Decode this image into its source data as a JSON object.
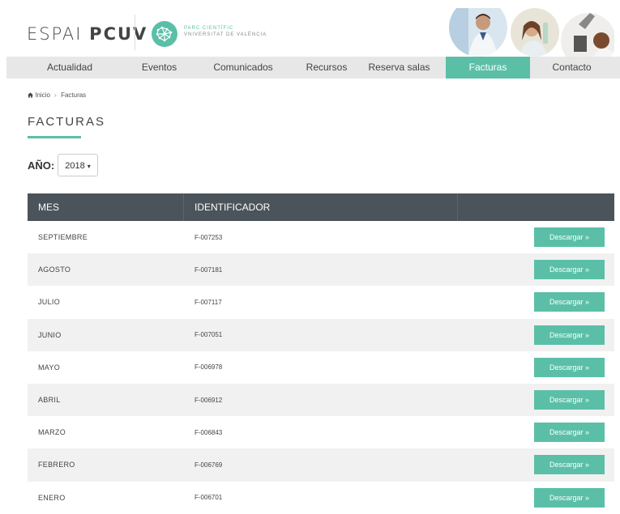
{
  "header": {
    "logo_light": "ESPAI",
    "logo_bold": "PCUV",
    "parc_line1": "PARC CIENTÍFIC",
    "parc_line2": "VNIVERSITAT DE VALÈNCIA"
  },
  "nav": {
    "items": [
      "Actualidad",
      "Eventos",
      "Comunicados",
      "Recursos",
      "Reserva salas",
      "Facturas",
      "Contacto"
    ]
  },
  "breadcrumb": {
    "home": "Inicio",
    "separator": "›",
    "current": "Facturas"
  },
  "page": {
    "title": "FACTURAS",
    "year_label": "AÑO:",
    "year_value": "2018",
    "year_caret": "▾"
  },
  "table": {
    "headers": [
      "MES",
      "IDENTIFICADOR",
      ""
    ],
    "button_label": "Descargar »",
    "rows": [
      {
        "mes": "SEPTIEMBRE",
        "id": "F-007253"
      },
      {
        "mes": "AGOSTO",
        "id": "F-007181"
      },
      {
        "mes": "JULIO",
        "id": "F-007117"
      },
      {
        "mes": "JUNIO",
        "id": "F-007051"
      },
      {
        "mes": "MAYO",
        "id": "F-006978"
      },
      {
        "mes": "ABRIL",
        "id": "F-006912"
      },
      {
        "mes": "MARZO",
        "id": "F-006843"
      },
      {
        "mes": "FEBRERO",
        "id": "F-006769"
      },
      {
        "mes": "ENERO",
        "id": "F-006701"
      }
    ]
  },
  "colors": {
    "accent": "#5bbfa8",
    "header_dark": "#4b545a",
    "nav_bg": "#e7e7e7"
  }
}
